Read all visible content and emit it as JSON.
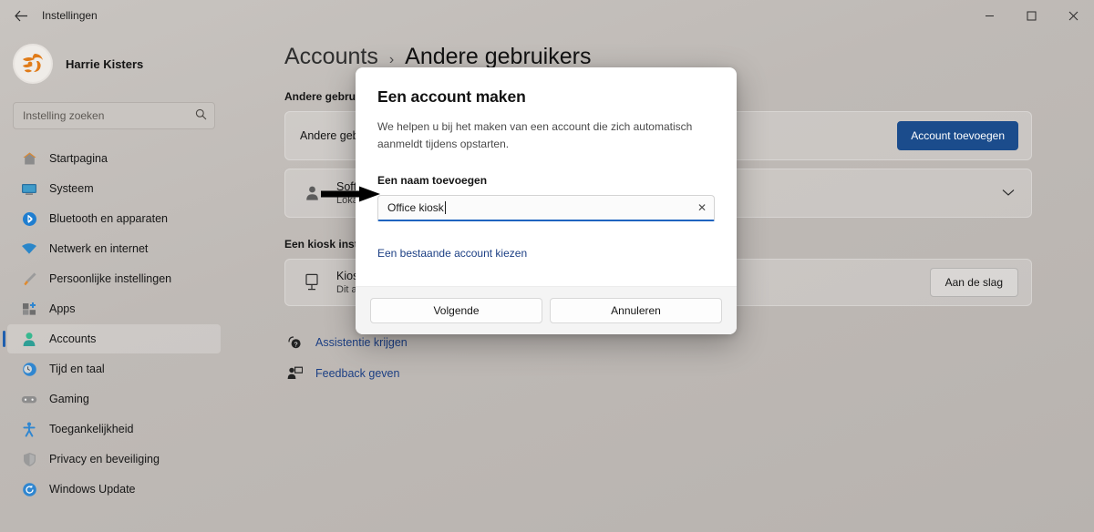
{
  "window": {
    "title": "Instellingen",
    "back_icon": "back-arrow-icon",
    "minimize": "–",
    "maximize": "☐",
    "close": "✕"
  },
  "sidebar": {
    "profile": {
      "name": "Harrie Kisters",
      "avatar_icon": "user-avatar-icon"
    },
    "search": {
      "placeholder": "Instelling zoeken",
      "value": "",
      "icon": "search-icon"
    },
    "items": [
      {
        "label": "Startpagina",
        "icon": "home-icon",
        "active": false
      },
      {
        "label": "Systeem",
        "icon": "monitor-icon",
        "active": false
      },
      {
        "label": "Bluetooth en apparaten",
        "icon": "bluetooth-icon",
        "active": false
      },
      {
        "label": "Netwerk en internet",
        "icon": "wifi-icon",
        "active": false
      },
      {
        "label": "Persoonlijke instellingen",
        "icon": "paintbrush-icon",
        "active": false
      },
      {
        "label": "Apps",
        "icon": "apps-icon",
        "active": false
      },
      {
        "label": "Accounts",
        "icon": "account-person-icon",
        "active": true
      },
      {
        "label": "Tijd en taal",
        "icon": "clock-globe-icon",
        "active": false
      },
      {
        "label": "Gaming",
        "icon": "gamepad-icon",
        "active": false
      },
      {
        "label": "Toegankelijkheid",
        "icon": "accessibility-icon",
        "active": false
      },
      {
        "label": "Privacy en beveiliging",
        "icon": "shield-icon",
        "active": false
      },
      {
        "label": "Windows Update",
        "icon": "update-refresh-icon",
        "active": false
      }
    ]
  },
  "main": {
    "breadcrumb": {
      "parent": "Accounts",
      "separator": "›",
      "current": "Andere gebruikers"
    },
    "other_users": {
      "section_label": "Andere gebruikers",
      "row_title": "Andere gebruiker toevoegen",
      "add_button": "Account toevoegen"
    },
    "user_row": {
      "name": "Software",
      "sub": "Lokaal account",
      "icon": "person-icon",
      "chevron": "⌄"
    },
    "kiosk": {
      "section_label": "Een kiosk instellen",
      "row_title": "Kiosk",
      "row_sub": "Dit apparaat gebruiken als digitale bewegwijzering, interactieve display of andere dingen",
      "icon": "kiosk-display-icon",
      "button": "Aan de slag"
    },
    "links": [
      {
        "label": "Assistentie krijgen",
        "icon": "help-question-icon"
      },
      {
        "label": "Feedback geven",
        "icon": "feedback-icon"
      }
    ]
  },
  "modal": {
    "title": "Een account maken",
    "description": "We helpen u bij het maken van een account die zich automatisch aanmeldt tijdens opstarten.",
    "field_label": "Een naam toevoegen",
    "input_value": "Office kiosk",
    "clear_icon": "✕",
    "existing_account_link": "Een bestaande account kiezen",
    "next_button": "Volgende",
    "cancel_button": "Annuleren"
  },
  "annotation": {
    "arrow_icon": "pointer-arrow-icon"
  },
  "colors": {
    "accent_blue": "#1b4c8c",
    "link_blue": "#1c3f84",
    "focus_underline": "#1f64c0",
    "selection_indicator": "#1f5fae",
    "desktop_bg": "#c3bfbc"
  }
}
